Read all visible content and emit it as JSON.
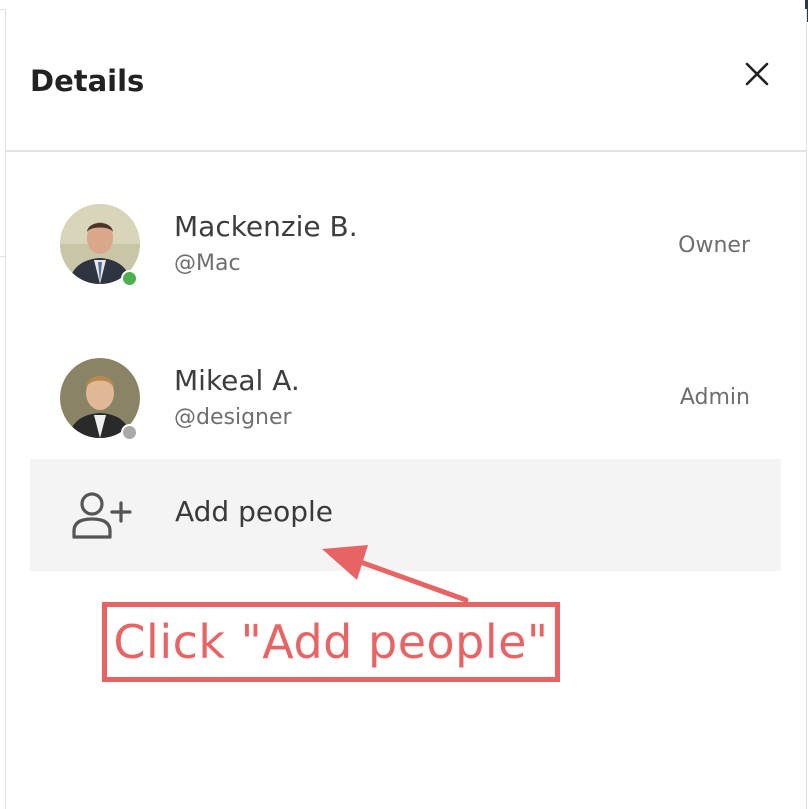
{
  "panel": {
    "title": "Details",
    "close_icon": "close-icon"
  },
  "members": [
    {
      "name": "Mackenzie B.",
      "handle": "@Mac",
      "role": "Owner",
      "status": "online",
      "status_color": "#4caf50"
    },
    {
      "name": "Mikeal A.",
      "handle": "@designer",
      "role": "Admin",
      "status": "offline",
      "status_color": "#a9a9a9"
    }
  ],
  "add_people": {
    "label": "Add people",
    "icon": "add-user-icon"
  },
  "annotation": {
    "text": "Click \"Add people\"",
    "color": "#e86464"
  }
}
